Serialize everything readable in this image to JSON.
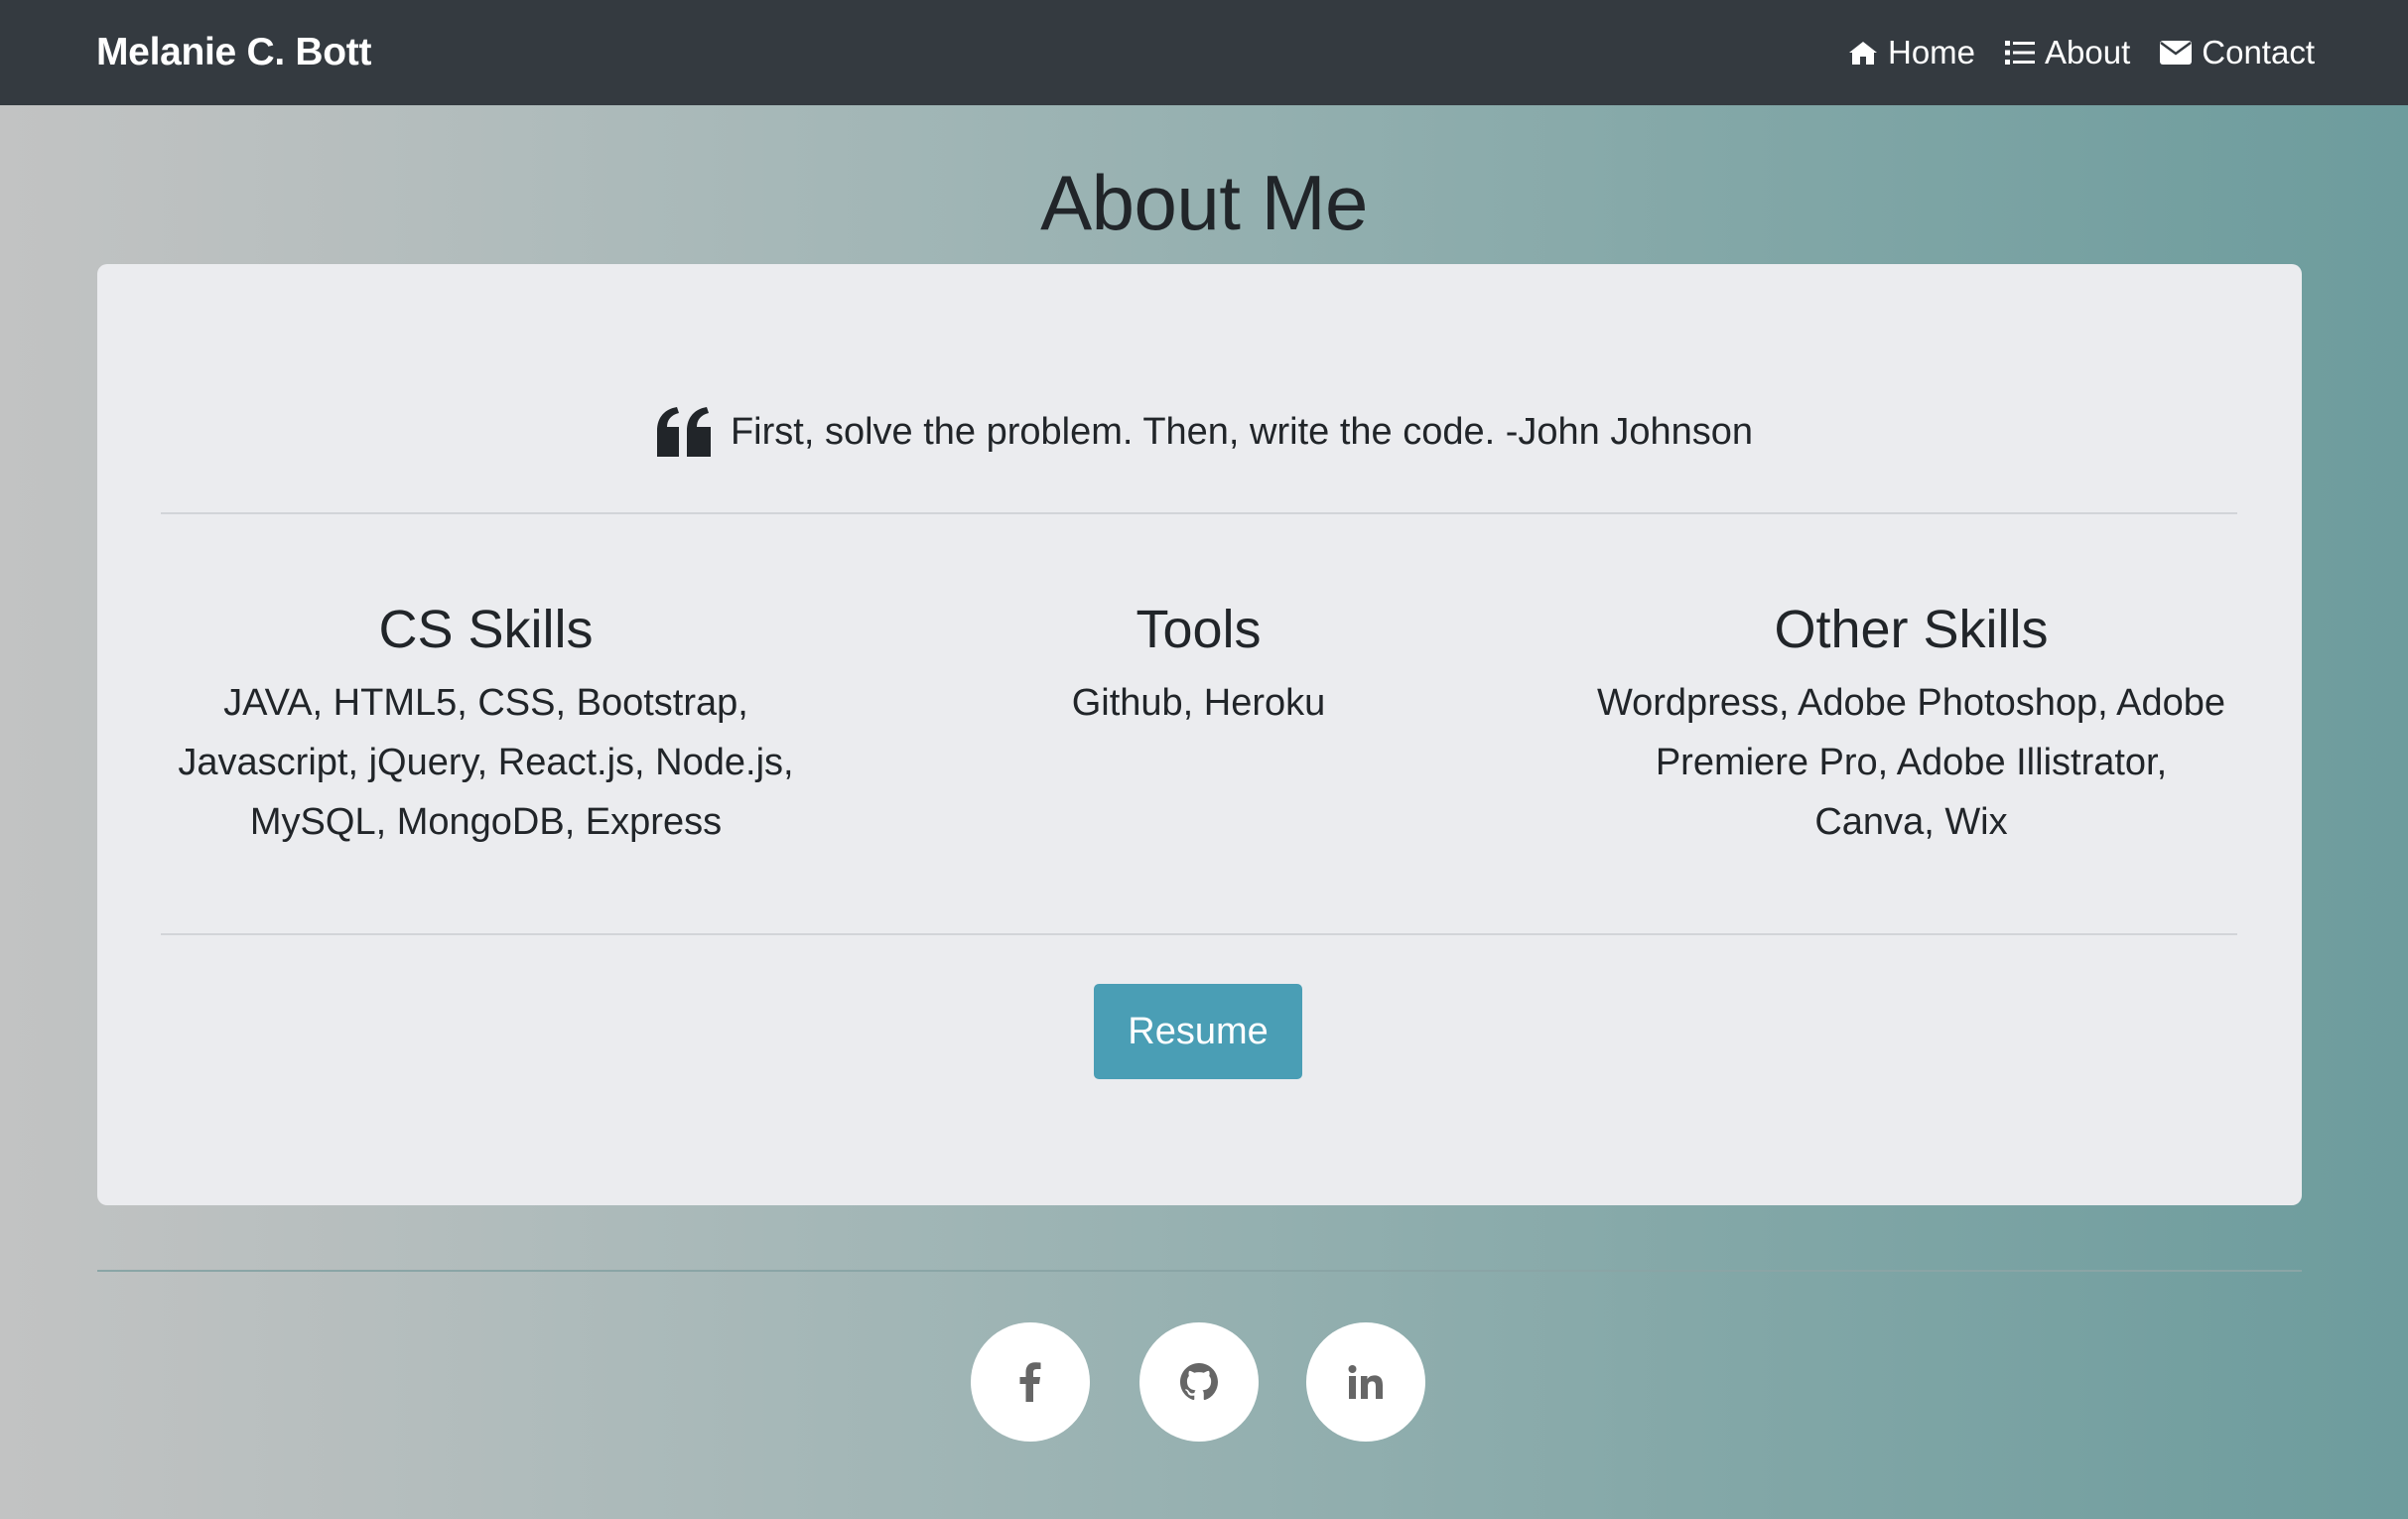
{
  "navbar": {
    "brand": "Melanie C. Bott",
    "links": [
      {
        "label": "Home",
        "icon": "home-icon"
      },
      {
        "label": "About",
        "icon": "list-icon"
      },
      {
        "label": "Contact",
        "icon": "envelope-icon"
      }
    ]
  },
  "page": {
    "title": "About Me"
  },
  "quote": {
    "icon": "quote-left-icon",
    "text": "First, solve the problem. Then, write the code. -John Johnson"
  },
  "skills": [
    {
      "title": "CS Skills",
      "text": "JAVA, HTML5, CSS, Bootstrap, Javascript, jQuery, React.js, Node.js, MySQL, MongoDB, Express"
    },
    {
      "title": "Tools",
      "text": "Github, Heroku"
    },
    {
      "title": "Other Skills",
      "text": "Wordpress, Adobe Photoshop, Adobe Premiere Pro, Adobe Illistrator, Canva, Wix"
    }
  ],
  "resume": {
    "label": "Resume"
  },
  "footer": {
    "social": [
      {
        "icon": "facebook-icon"
      },
      {
        "icon": "github-icon"
      },
      {
        "icon": "linkedin-icon"
      }
    ]
  },
  "colors": {
    "navbar_bg": "#343a40",
    "card_bg": "#ebecef",
    "button_bg": "#4a9eb5",
    "gradient_start": "#c2c3c3",
    "gradient_end": "#6d9c9d"
  }
}
